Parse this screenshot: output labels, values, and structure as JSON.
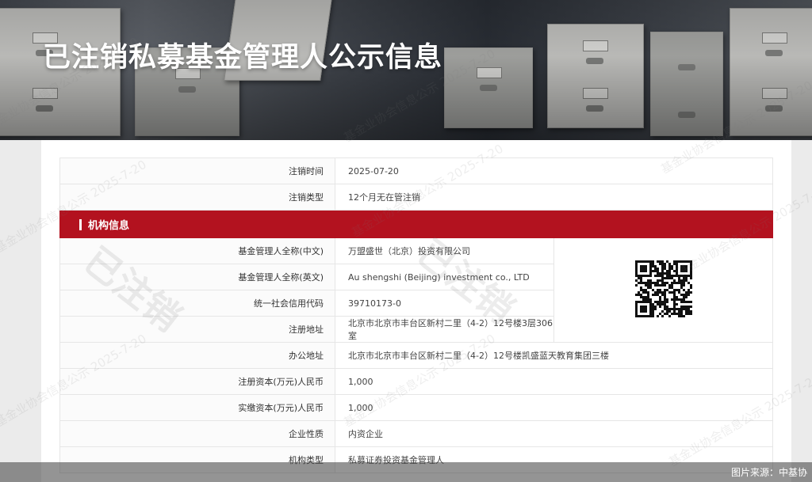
{
  "header": {
    "title": "已注销私募基金管理人公示信息"
  },
  "cancellation": [
    {
      "label": "注销时间",
      "value": "2025-07-20"
    },
    {
      "label": "注销类型",
      "value": "12个月无在管注销"
    }
  ],
  "section": {
    "title": "机构信息"
  },
  "institution": [
    {
      "label": "基金管理人全称(中文)",
      "value": "万盟盛世（北京）投资有限公司"
    },
    {
      "label": "基金管理人全称(英文)",
      "value": "Au shengshi (Beijing) investment co., LTD"
    },
    {
      "label": "统一社会信用代码",
      "value": "39710173-0"
    },
    {
      "label": "注册地址",
      "value": "北京市北京市丰台区新村二里（4-2）12号楼3层306室"
    },
    {
      "label": "办公地址",
      "value": "北京市北京市丰台区新村二里（4-2）12号楼凯盛蓝天教育集团三楼"
    },
    {
      "label": "注册资本(万元)人民币",
      "value": "1,000"
    },
    {
      "label": "实缴资本(万元)人民币",
      "value": "1,000"
    },
    {
      "label": "企业性质",
      "value": "内资企业"
    },
    {
      "label": "机构类型",
      "value": "私募证券投资基金管理人"
    }
  ],
  "watermark": {
    "small": "基金业协会信息公示 2025-7-20",
    "big": "已注销"
  },
  "footer": {
    "caption": "图片来源：中基协"
  },
  "colors": {
    "section_red": "#b3121f",
    "title_white": "#ffffff"
  }
}
